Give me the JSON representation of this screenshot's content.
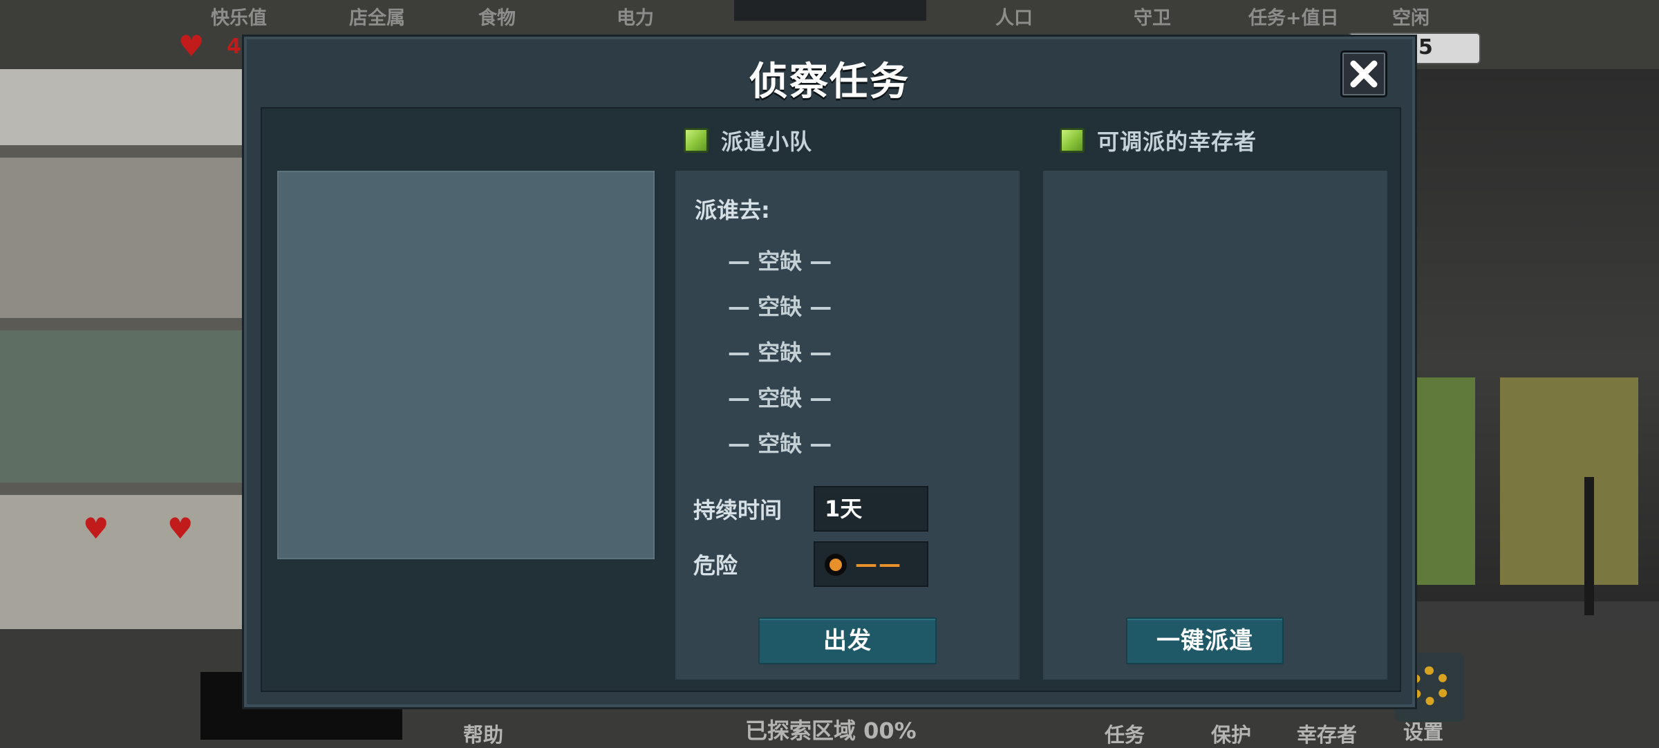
{
  "background": {
    "top_stats": [
      "快乐值",
      "店全属",
      "食物",
      "电力",
      "人口",
      "守卫",
      "任务+值日",
      "空闲"
    ],
    "heart_value": "4",
    "counter_value": "5",
    "bottom_labels": [
      "帮助",
      "任务",
      "保护",
      "幸存者",
      "设置"
    ],
    "status_text": "已探索区域 00%"
  },
  "modal": {
    "title": "侦察任务",
    "close_icon": "close-icon",
    "squad_section": {
      "header": "派遣小队",
      "who_label": "派谁去:",
      "slots": [
        "— 空缺 —",
        "— 空缺 —",
        "— 空缺 —",
        "— 空缺 —",
        "— 空缺 —"
      ],
      "duration_label": "持续时间",
      "duration_value": "1天",
      "danger_label": "危险",
      "danger_value": "——",
      "depart_button": "出发"
    },
    "survivors_section": {
      "header": "可调派的幸存者",
      "auto_dispatch_button": "一键派遣"
    }
  },
  "colors": {
    "checkbox": "#8ac43a",
    "button": "#1f5968",
    "danger": "#e8912a",
    "panel": "#34444e"
  }
}
